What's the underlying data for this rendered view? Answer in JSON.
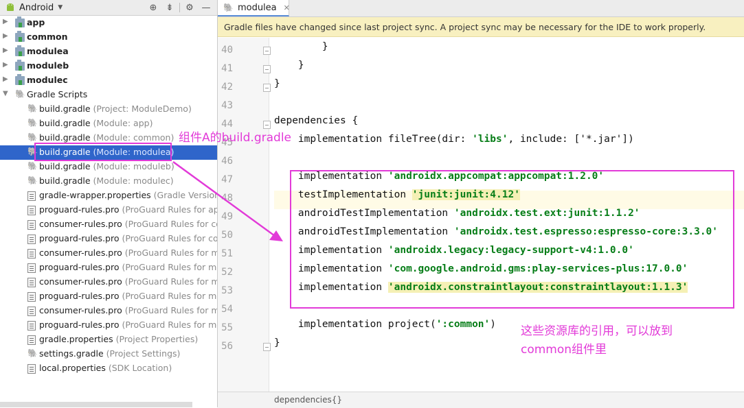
{
  "left_panel": {
    "view_label": "Android",
    "toolbar_icons": [
      "target-icon",
      "collapse-icon",
      "gear-icon",
      "minimize-icon"
    ],
    "tree": [
      {
        "label": "app",
        "hint": "",
        "kind": "module",
        "bold": true
      },
      {
        "label": "common",
        "hint": "",
        "kind": "module",
        "bold": true
      },
      {
        "label": "modulea",
        "hint": "",
        "kind": "module",
        "bold": true
      },
      {
        "label": "moduleb",
        "hint": "",
        "kind": "module",
        "bold": true
      },
      {
        "label": "modulec",
        "hint": "",
        "kind": "module",
        "bold": true
      },
      {
        "label": "Gradle Scripts",
        "hint": "",
        "kind": "group",
        "bold": false
      },
      {
        "label": "build.gradle",
        "hint": "(Project: ModuleDemo)",
        "kind": "gradle"
      },
      {
        "label": "build.gradle",
        "hint": "(Module: app)",
        "kind": "gradle"
      },
      {
        "label": "build.gradle",
        "hint": "(Module: common)",
        "kind": "gradle"
      },
      {
        "label": "build.gradle",
        "hint": "(Module: modulea)",
        "kind": "gradle",
        "selected": true
      },
      {
        "label": "build.gradle",
        "hint": "(Module: moduleb)",
        "kind": "gradle"
      },
      {
        "label": "build.gradle",
        "hint": "(Module: modulec)",
        "kind": "gradle"
      },
      {
        "label": "gradle-wrapper.properties",
        "hint": "(Gradle Version)",
        "kind": "file"
      },
      {
        "label": "proguard-rules.pro",
        "hint": "(ProGuard Rules for app",
        "kind": "file"
      },
      {
        "label": "consumer-rules.pro",
        "hint": "(ProGuard Rules for com",
        "kind": "file"
      },
      {
        "label": "proguard-rules.pro",
        "hint": "(ProGuard Rules for com",
        "kind": "file"
      },
      {
        "label": "consumer-rules.pro",
        "hint": "(ProGuard Rules for mo",
        "kind": "file"
      },
      {
        "label": "proguard-rules.pro",
        "hint": "(ProGuard Rules for mo",
        "kind": "file"
      },
      {
        "label": "consumer-rules.pro",
        "hint": "(ProGuard Rules for mo",
        "kind": "file"
      },
      {
        "label": "proguard-rules.pro",
        "hint": "(ProGuard Rules for mo",
        "kind": "file"
      },
      {
        "label": "consumer-rules.pro",
        "hint": "(ProGuard Rules for mo",
        "kind": "file"
      },
      {
        "label": "proguard-rules.pro",
        "hint": "(ProGuard Rules for mo",
        "kind": "file"
      },
      {
        "label": "gradle.properties",
        "hint": "(Project Properties)",
        "kind": "file"
      },
      {
        "label": "settings.gradle",
        "hint": "(Project Settings)",
        "kind": "gradle"
      },
      {
        "label": "local.properties",
        "hint": "(SDK Location)",
        "kind": "file"
      }
    ]
  },
  "editor": {
    "tab_label": "modulea",
    "banner": "Gradle files have changed since last project sync. A project sync may be necessary for the IDE to work properly.",
    "line_numbers": [
      "40",
      "41",
      "42",
      "43",
      "44",
      "45",
      "46",
      "47",
      "48",
      "49",
      "50",
      "51",
      "52",
      "53",
      "54",
      "55",
      "56"
    ],
    "lines": [
      {
        "pre": "        }",
        "str": "",
        "post": ""
      },
      {
        "pre": "    }",
        "str": "",
        "post": ""
      },
      {
        "pre": "}",
        "str": "",
        "post": ""
      },
      {
        "pre": "",
        "str": "",
        "post": ""
      },
      {
        "pre": "dependencies {",
        "str": "",
        "post": ""
      },
      {
        "pre": "    implementation fileTree(dir: ",
        "str": "'libs'",
        "post": ", include: ['*.jar'])"
      },
      {
        "pre": "",
        "str": "",
        "post": ""
      },
      {
        "pre": "    implementation ",
        "str": "'androidx.appcompat:appcompat:1.2.0'",
        "post": ""
      },
      {
        "pre": "    testImplementation ",
        "str": "'junit:junit:4.12'",
        "post": ""
      },
      {
        "pre": "    androidTestImplementation ",
        "str": "'androidx.test.ext:junit:1.1.2'",
        "post": ""
      },
      {
        "pre": "    androidTestImplementation ",
        "str": "'androidx.test.espresso:espresso-core:3.3.0'",
        "post": ""
      },
      {
        "pre": "    implementation ",
        "str": "'androidx.legacy:legacy-support-v4:1.0.0'",
        "post": ""
      },
      {
        "pre": "    implementation ",
        "str": "'com.google.android.gms:play-services-plus:17.0.0'",
        "post": ""
      },
      {
        "pre": "    implementation ",
        "str": "'androidx.constraintlayout:constraintlayout:1.1.3'",
        "post": ""
      },
      {
        "pre": "",
        "str": "",
        "post": ""
      },
      {
        "pre": "    implementation project(",
        "str": "':common'",
        "post": ")"
      },
      {
        "pre": "}",
        "str": "",
        "post": ""
      }
    ],
    "status_text": "dependencies{}"
  },
  "annotations": {
    "selected_note": "组件A的build.gradle",
    "deps_note_line1": "这些资源库的引用，可以放到",
    "deps_note_line2": "common组件里",
    "color": "#e23ad8"
  }
}
